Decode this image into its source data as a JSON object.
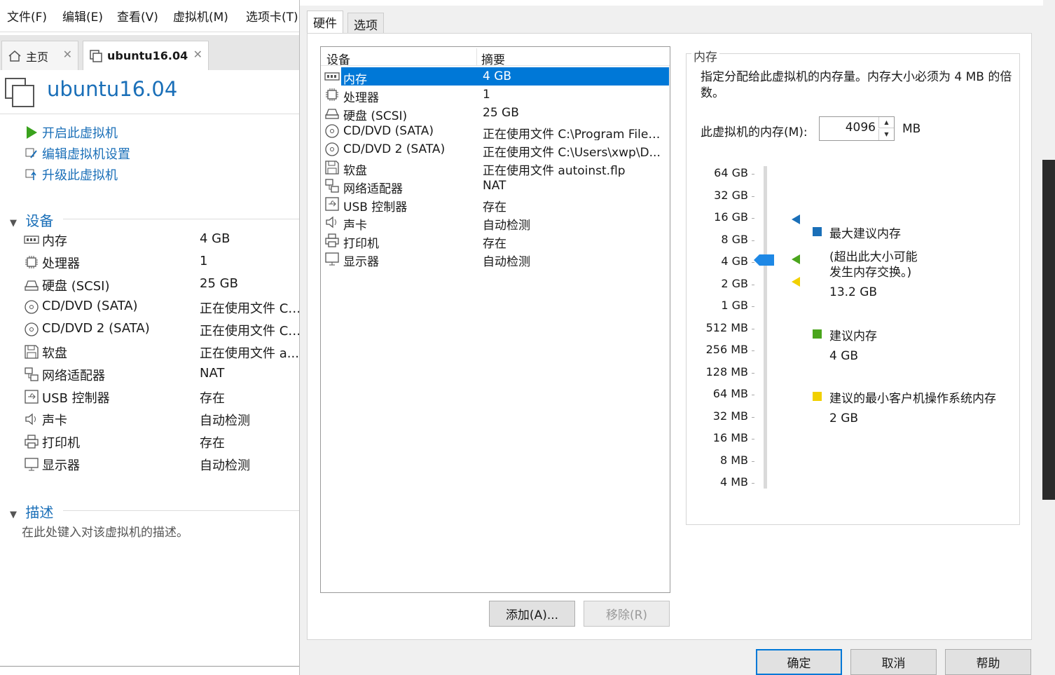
{
  "menubar": {
    "items": [
      "文件(F)",
      "编辑(E)",
      "查看(V)",
      "虚拟机(M)",
      "选项卡(T)"
    ]
  },
  "tabs": [
    {
      "label": "主页"
    },
    {
      "label": "ubuntu16.04"
    }
  ],
  "vm": {
    "title": "ubuntu16.04",
    "actions": [
      "开启此虚拟机",
      "编辑虚拟机设置",
      "升级此虚拟机"
    ]
  },
  "devices_section": {
    "title": "设备",
    "rows": [
      {
        "icon": "memory-icon",
        "name": "内存",
        "value": "4 GB"
      },
      {
        "icon": "processor-icon",
        "name": "处理器",
        "value": "1"
      },
      {
        "icon": "harddisk-icon",
        "name": "硬盘 (SCSI)",
        "value": "25 GB"
      },
      {
        "icon": "cd-icon",
        "name": "CD/DVD (SATA)",
        "value": "正在使用文件 C:..."
      },
      {
        "icon": "cd-icon",
        "name": "CD/DVD 2 (SATA)",
        "value": "正在使用文件 C:..."
      },
      {
        "icon": "floppy-icon",
        "name": "软盘",
        "value": "正在使用文件 a..."
      },
      {
        "icon": "network-icon",
        "name": "网络适配器",
        "value": "NAT"
      },
      {
        "icon": "usb-icon",
        "name": "USB 控制器",
        "value": "存在"
      },
      {
        "icon": "sound-icon",
        "name": "声卡",
        "value": "自动检测"
      },
      {
        "icon": "printer-icon",
        "name": "打印机",
        "value": "存在"
      },
      {
        "icon": "display-icon",
        "name": "显示器",
        "value": "自动检测"
      }
    ]
  },
  "description_section": {
    "title": "描述",
    "placeholder": "在此处键入对该虚拟机的描述。"
  },
  "dialog": {
    "tabs": [
      "硬件",
      "选项"
    ],
    "list_headers": {
      "device": "设备",
      "summary": "摘要"
    },
    "list_rows": [
      {
        "name": "内存",
        "summary": "4 GB",
        "selected": true
      },
      {
        "name": "处理器",
        "summary": "1"
      },
      {
        "name": "硬盘 (SCSI)",
        "summary": "25 GB"
      },
      {
        "name": "CD/DVD (SATA)",
        "summary": "正在使用文件 C:\\Program Files..."
      },
      {
        "name": "CD/DVD 2 (SATA)",
        "summary": "正在使用文件 C:\\Users\\xwp\\D..."
      },
      {
        "name": "软盘",
        "summary": "正在使用文件 autoinst.flp"
      },
      {
        "name": "网络适配器",
        "summary": "NAT"
      },
      {
        "name": "USB 控制器",
        "summary": "存在"
      },
      {
        "name": "声卡",
        "summary": "自动检测"
      },
      {
        "name": "打印机",
        "summary": "存在"
      },
      {
        "name": "显示器",
        "summary": "自动检测"
      }
    ],
    "add_button": "添加(A)...",
    "remove_button": "移除(R)",
    "memory": {
      "group_title": "内存",
      "description": "指定分配给此虚拟机的内存量。内存大小必须为 4 MB 的倍数。",
      "field_label": "此虚拟机的内存(M):",
      "field_value": "4096",
      "unit": "MB",
      "scale_ticks": [
        "64 GB",
        "32 GB",
        "16 GB",
        "8 GB",
        "4 GB",
        "2 GB",
        "1 GB",
        "512 MB",
        "256 MB",
        "128 MB",
        "64 MB",
        "32 MB",
        "16 MB",
        "8 MB",
        "4 MB"
      ],
      "slider_value": "4 GB",
      "max_recommended": {
        "label": "最大建议内存",
        "note1": "(超出此大小可能",
        "note2": "发生内存交换。)",
        "value": "13.2 GB",
        "color": "#1a6fb8"
      },
      "recommended": {
        "label": "建议内存",
        "value": "4 GB",
        "color": "#4aa51c"
      },
      "min_recommended": {
        "label": "建议的最小客户机操作系统内存",
        "value": "2 GB",
        "color": "#f1d000"
      }
    },
    "ok_button": "确定",
    "cancel_button": "取消",
    "help_button": "帮助"
  }
}
